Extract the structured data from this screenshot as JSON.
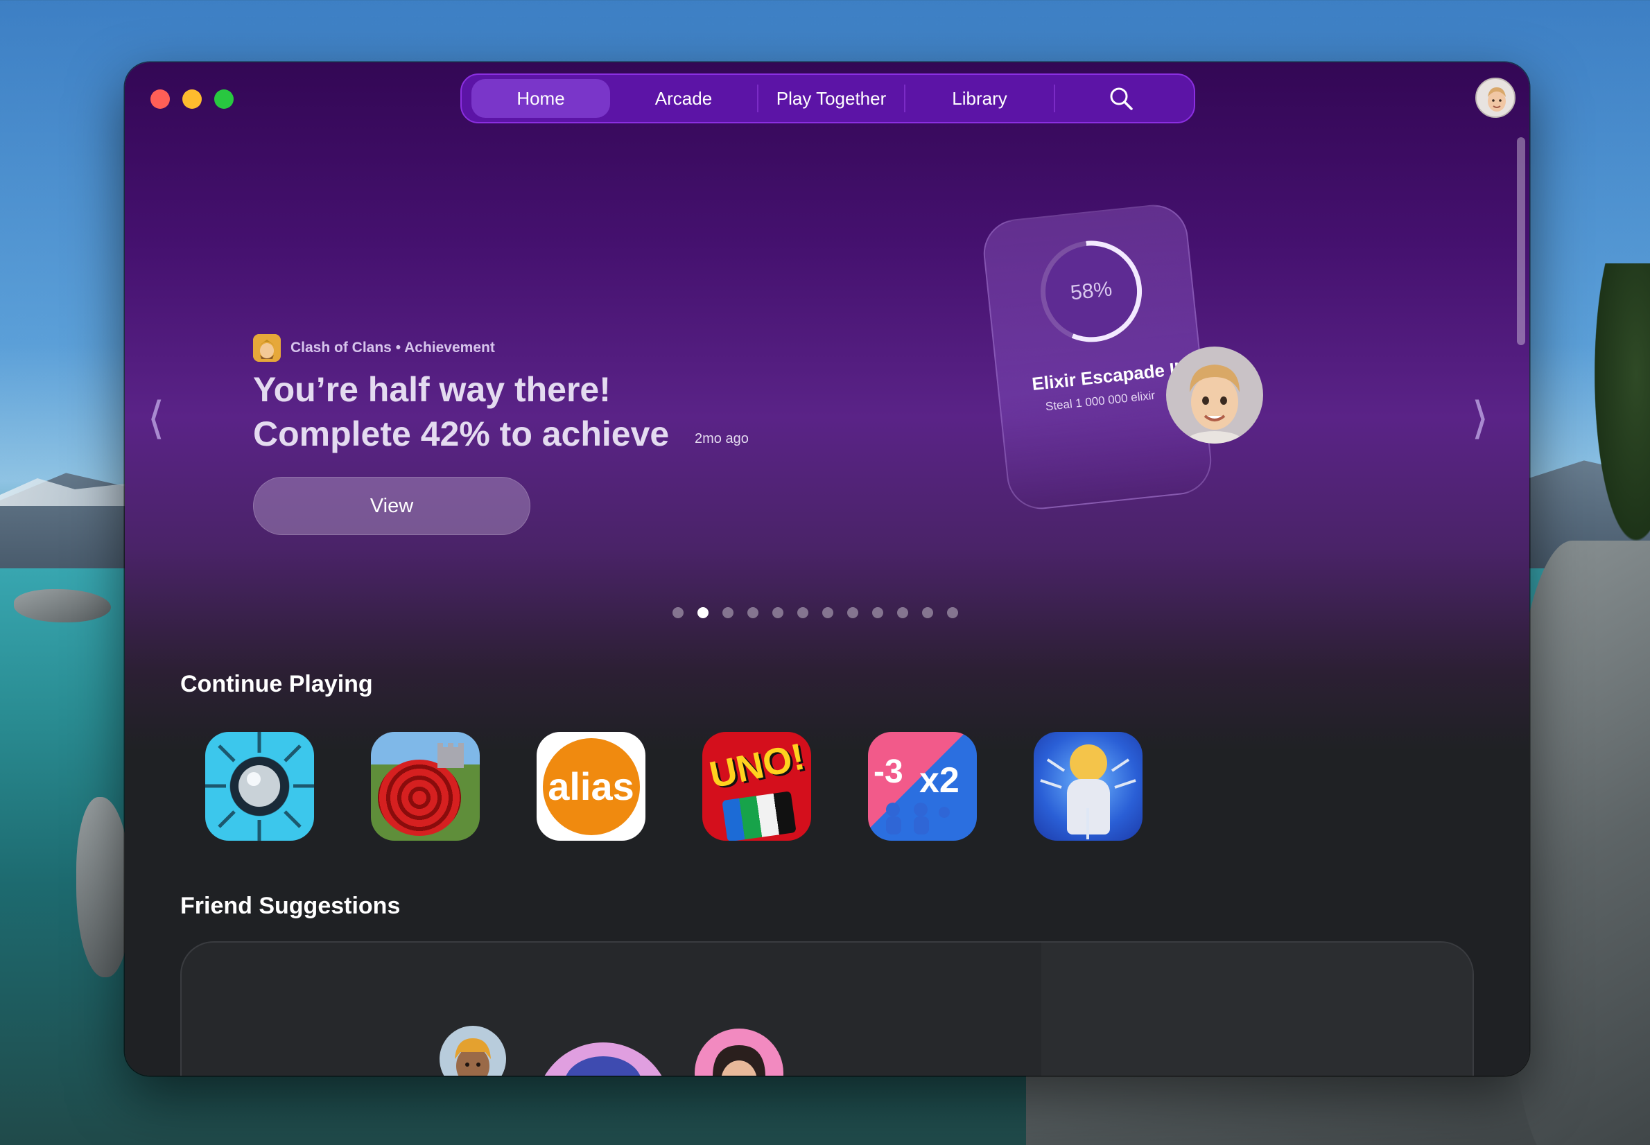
{
  "nav": {
    "tabs": [
      {
        "label": "Home",
        "active": true
      },
      {
        "label": "Arcade"
      },
      {
        "label": "Play Together"
      },
      {
        "label": "Library"
      }
    ],
    "search_icon": "search-icon"
  },
  "hero": {
    "game": "Clash of Clans",
    "category": "Achievement",
    "meta_label": "Clash of Clans • Achievement",
    "title_line1": "You’re half way there!",
    "title_line2": "Complete 42% to achieve",
    "time": "2mo ago",
    "button": "View",
    "achievement": {
      "progress_label": "58%",
      "progress": 0.58,
      "name": "Elixir Escapade II",
      "description": "Steal 1 000 000 elixir"
    }
  },
  "carousel": {
    "total": 12,
    "active_index": 1
  },
  "continue_playing": {
    "title": "Continue Playing",
    "games": [
      {
        "icon": "pinball-game-icon"
      },
      {
        "icon": "snake-castle-game-icon"
      },
      {
        "icon": "alias-game-icon",
        "label": "alias"
      },
      {
        "icon": "uno-game-icon",
        "label": "UNO!"
      },
      {
        "icon": "crowd-runner-game-icon",
        "label_a": "-3",
        "label_b": "x2"
      },
      {
        "icon": "sword-hero-game-icon"
      }
    ]
  },
  "friend_suggestions": {
    "title": "Friend Suggestions"
  },
  "colors": {
    "accent": "#7a36c9",
    "nav_bg": "#5c14a6",
    "bg_dark": "#1f2124"
  }
}
